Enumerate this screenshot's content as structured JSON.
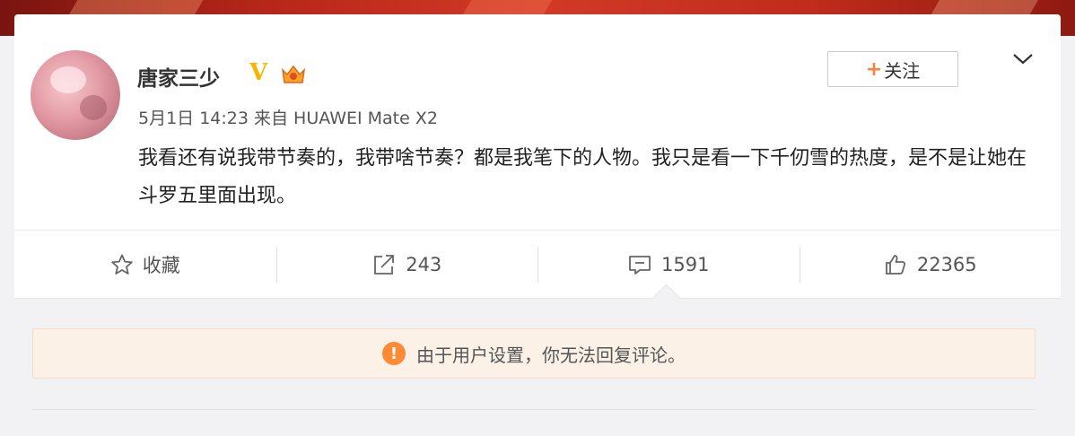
{
  "post": {
    "author": "唐家三少",
    "meta": "5月1日 14:23 来自 HUAWEI Mate X2",
    "content": "我看还有说我带节奏的，我带啥节奏？都是我笔下的人物。我只是看一下千仞雪的热度，是不是让她在斗罗五里面出现。",
    "follow_plus": "+",
    "follow_label": "关注",
    "verified_badge": "V"
  },
  "actions": {
    "favorite_label": "收藏",
    "repost_count": "243",
    "comment_count": "1591",
    "like_count": "22365"
  },
  "notice": {
    "icon_glyph": "!",
    "text": "由于用户设置，你无法回复评论。"
  },
  "icons": [
    "star-icon",
    "share-icon",
    "comment-icon",
    "like-icon",
    "chevron-down-icon",
    "warning-icon",
    "crown-icon",
    "verified-icon"
  ],
  "colors": {
    "accent": "#ff8140",
    "verified": "#f7b500",
    "notice_bg": "#fbf1e6"
  }
}
